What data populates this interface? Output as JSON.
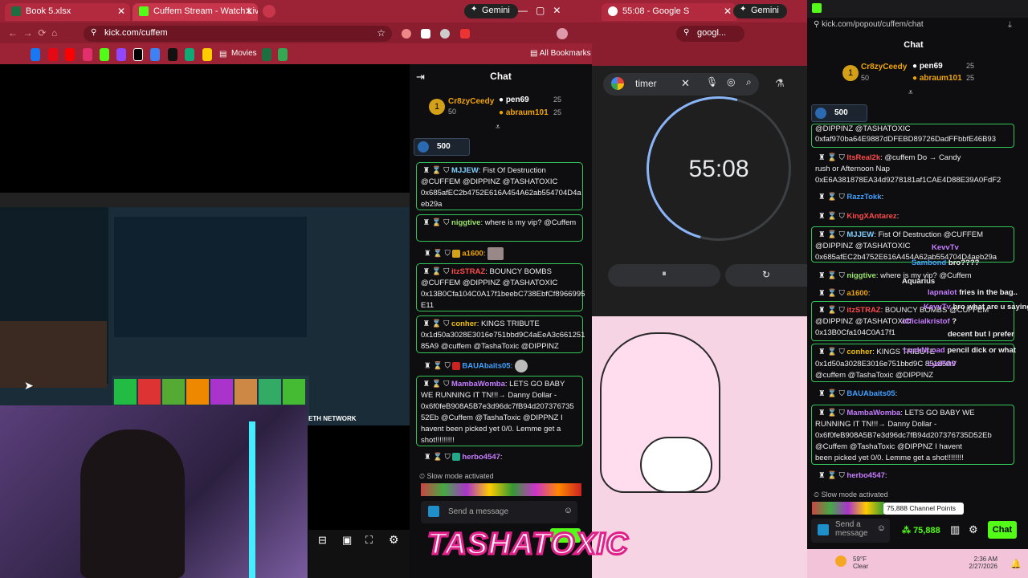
{
  "left_browser": {
    "tabs": [
      {
        "label": "Book 5.xlsx",
        "color": "#1d6f42"
      },
      {
        "label": "Cuffem Stream - Watch Live on",
        "color": "#53fc18"
      }
    ],
    "gemini_label": "Gemini",
    "url": "kick.com/cuffem",
    "bookmarks_movies": "Movies",
    "all_bookmarks": "All Bookmarks"
  },
  "chat1": {
    "title": "Chat",
    "top": [
      {
        "name": "Cr8zyCeedy",
        "pts": "50"
      },
      {
        "name": "pen69",
        "pts": "25"
      },
      {
        "name": "abraum101",
        "pts": "25"
      }
    ],
    "rank_1": "1",
    "points_pill": "500",
    "messages": [
      {
        "user": "MJJEW",
        "text": ": Fist Of Destruction @CUFFEM @DIPPINZ @TASHATOXIC 0x685afEC2b4752E616A454A62ab554704D4a eb29a"
      },
      {
        "user": "niggtive",
        "text": ": where is my vip? @Cuffem"
      },
      {
        "user": "a1600",
        "text": ":"
      },
      {
        "user": "itzSTRAZ",
        "text": ": BOUNCY BOMBS @CUFFEM @DIPPINZ @TASHATOXIC 0x13B0Cfa104C0A17f1beebC738EbfCf8966995 E11"
      },
      {
        "user": "conher",
        "text": ": KINGS TRIBUTE 0x1d50a3028E3016e751bbd9C4aEeA3c661251 85A9 @cuffem @TashaToxic @DIPPINZ"
      },
      {
        "user": "BAUAbaits05",
        "text": ":"
      },
      {
        "user": "MambaWomba",
        "text": ": LETS GO BABY WE RUNNING IT TN!!!→ Danny Dollar - 0x6f0feB908A5B7e3d96dc7fB94d207376735 52Eb @Cuffem @TashaToxic @DIPPNZ I havent been picked yet 0/0. Lemme get a shot!!!!!!!!!"
      },
      {
        "user": "herbo4547",
        "text": ":"
      }
    ],
    "slow_mode": "Slow mode activated",
    "send_placeholder": "Send a message"
  },
  "timer": {
    "search": "timer",
    "value": "55:08",
    "tab_label": "55:08 - Google S",
    "gemini": "Gemini",
    "url": "googl..."
  },
  "chat2": {
    "url": "kick.com/popout/cuffem/chat",
    "title": "Chat",
    "top": [
      {
        "name": "Cr8zyCeedy",
        "pts": "50"
      },
      {
        "name": "pen69",
        "pts": "25"
      },
      {
        "name": "abraum101",
        "pts": "25"
      }
    ],
    "rank_1": "1",
    "points_pill": "500",
    "lines": [
      {
        "text": "@DIPPINZ @TASHATOXIC"
      },
      {
        "text": "0xfaf970ba64E9887dDFEBD89726DadFFbbfE46B93"
      },
      {
        "user": "ItsReal2k",
        "text": ": @cuffem Do → Candy"
      },
      {
        "text": "rush or Afternoon Nap"
      },
      {
        "text": "0xE6A381878EA34d9278181af1CAE4D88E39A0FdF2"
      },
      {
        "user": "RazzTokk",
        "text": ":"
      },
      {
        "user": "KingXAntarez",
        "text": ":"
      },
      {
        "user": "MJJEW",
        "text": ": Fist Of Destruction @CUFFEM"
      },
      {
        "text": "@DIPPINZ @TASHATOXIC"
      },
      {
        "text": "0x685afEC2b4752E616A454A62ab554704D4aeb29a"
      },
      {
        "user": "niggtive",
        "text": ": where is my vip? @Cuffem"
      },
      {
        "user": "a1600",
        "text": ":"
      },
      {
        "user": "itzSTRAZ",
        "text": ": BOUNCY BOMBS @CUFFEM"
      },
      {
        "text": "@DIPPINZ @TASHATOXIC"
      },
      {
        "text": "0x13B0Cfa104C0A17f1"
      },
      {
        "user": "conher",
        "text": ": KINGS TRIBUTE"
      },
      {
        "text": "0x1d50a3028E3016e751bbd9C                 85185A9"
      },
      {
        "text": "@cuffem @TashaToxic @DIPPINZ"
      },
      {
        "user": "BAUAbaits05",
        "text": ":"
      },
      {
        "user": "MambaWomba",
        "text": ": LETS GO BABY WE"
      },
      {
        "text": "RUNNING IT TN!!!→ Danny Dollar -"
      },
      {
        "text": "0x6f0feB908A5B7e3d96dc7fB94d207376735D52Eb"
      },
      {
        "text": "@Cuffem @TashaToxic @DIPPNZ I havent"
      },
      {
        "text": "been picked yet 0/0. Lemme get a shot!!!!!!!!"
      },
      {
        "user": "herbo4547",
        "text": ":"
      }
    ],
    "overlay": [
      {
        "user": "KevvTv",
        "text": ""
      },
      {
        "user": "Sambond",
        "text": "bro????"
      },
      {
        "user": "Aquarius",
        "text": ""
      },
      {
        "user": "lapnalot",
        "text": "fries in the bag.."
      },
      {
        "user": "KevvTv",
        "text": "bro what are u saying"
      },
      {
        "user": "officialkristof",
        "text": "?"
      },
      {
        "user": "",
        "text": "decent but I prefer"
      },
      {
        "user": "LuckNLoad",
        "text": "pencil dick or what"
      },
      {
        "user": "LysPOV",
        "text": ""
      }
    ],
    "slow_mode": "Slow mode activated",
    "send_placeholder": "Send a message",
    "points": "75,888",
    "points_tooltip": "75,888 Channel Points",
    "chat_button": "Chat"
  },
  "stream_overlay": {
    "name": "TASHATOXIC",
    "eth": "ETH NETWORK"
  },
  "taskbar": {
    "weather": "59°F",
    "weather_desc": "Clear",
    "time": "2:36 AM",
    "date": "2/27/2026"
  }
}
